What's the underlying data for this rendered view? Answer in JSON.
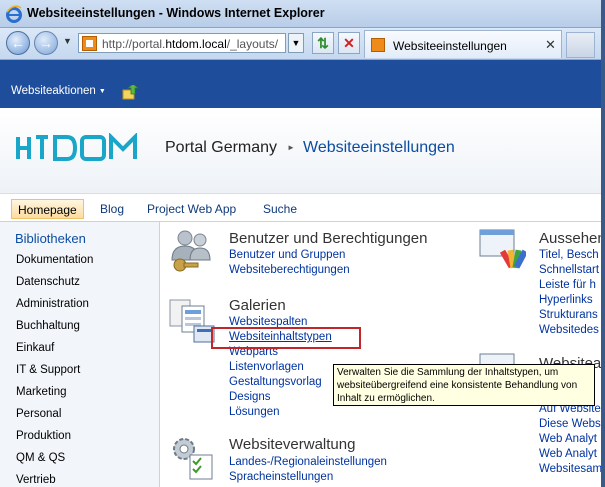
{
  "window": {
    "title": "Websiteeinstellungen - Windows Internet Explorer"
  },
  "browser": {
    "url": "http://portal.htdom.local/_layouts/",
    "url_prefix": "http://portal.",
    "url_host": "htdom.local",
    "url_path": "/_layouts/",
    "tab_title": "Websiteeinstellungen"
  },
  "sharepoint": {
    "site_actions": "Websiteaktionen",
    "logo_text": "HiDOM",
    "breadcrumb_site": "Portal Germany",
    "breadcrumb_page": "Websiteeinstellungen",
    "top_nav": [
      "Homepage",
      "Blog",
      "Project Web App",
      "Suche"
    ],
    "left_nav": {
      "heading": "Bibliotheken",
      "items": [
        "Dokumentation",
        "Datenschutz",
        "Administration",
        "Buchhaltung",
        "Einkauf",
        "IT & Support",
        "Marketing",
        "Personal",
        "Produktion",
        "QM & QS",
        "Vertrieb"
      ]
    }
  },
  "sections": {
    "users": {
      "title": "Benutzer und Berechtigungen",
      "links": [
        "Benutzer und Gruppen",
        "Websiteberechtigungen"
      ]
    },
    "galleries": {
      "title": "Galerien",
      "links": [
        "Websitespalten",
        "Websiteinhaltstypen",
        "Webparts",
        "Listenvorlagen",
        "Gestaltungsvorlag",
        "Designs",
        "Lösungen"
      ]
    },
    "admin": {
      "title": "Websiteverwaltung",
      "links": [
        "Landes-/Regionaleinstellungen",
        "Spracheinstellungen"
      ]
    },
    "look": {
      "title": "Aussehen",
      "links": [
        "Titel, Besch",
        "Schnellstart",
        "Leiste für h",
        "Hyperlinks",
        "Strukturans",
        "Websitedes"
      ]
    },
    "website": {
      "title": "Websitea",
      "links": [
        "Auf Website",
        "Diese Websi",
        "Web Analyt",
        "Web Analyt",
        "Websitesam"
      ]
    }
  },
  "tooltip": "Verwalten Sie die Sammlung der Inhaltstypen, um websiteübergreifend eine konsistente Behandlung von Inhalt zu ermöglichen."
}
